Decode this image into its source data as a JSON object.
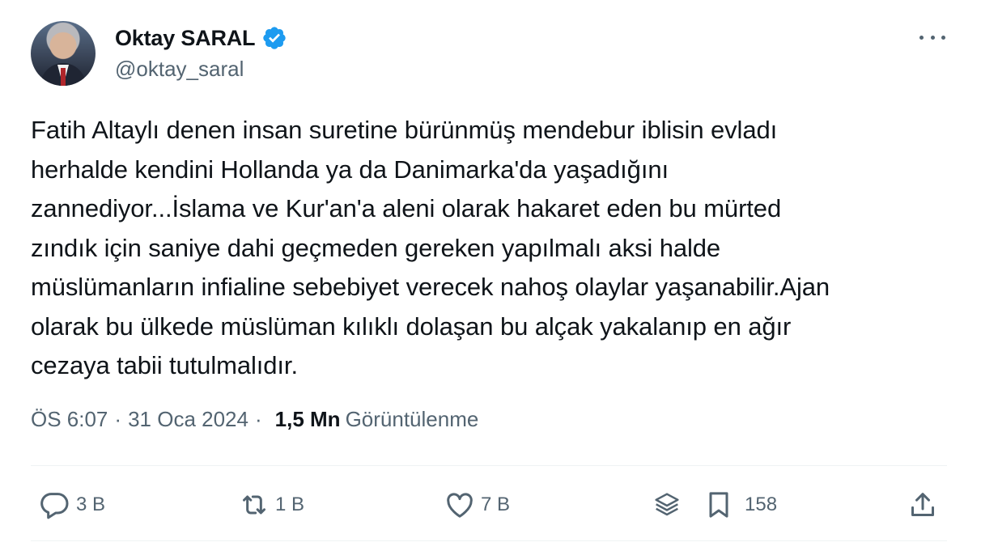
{
  "author": {
    "name": "Oktay SARAL",
    "handle": "@oktay_saral",
    "verified": true
  },
  "tweet": {
    "text": "Fatih Altaylı denen insan suretine bürünmüş mendebur iblisin evladı\nherhalde kendini Hollanda ya da Danimarka'da yaşadığını\nzannediyor...İslama ve Kur'an'a aleni olarak hakaret eden bu mürted\nzındık için saniye dahi geçmeden gereken yapılmalı aksi halde\nmüslümanların infialine sebebiyet verecek nahoş olaylar yaşanabilir.Ajan\nolarak bu ülkede müslüman kılıklı dolaşan bu alçak yakalanıp en ağır\ncezaya tabii tutulmalıdır."
  },
  "meta": {
    "time": "ÖS 6:07",
    "date": "31 Oca 2024",
    "separator": "·",
    "views_count": "1,5 Mn",
    "views_label": "Görüntülenme"
  },
  "actions": {
    "reply": {
      "icon": "reply-icon",
      "count": "3 B"
    },
    "retweet": {
      "icon": "retweet-icon",
      "count": "1 B"
    },
    "like": {
      "icon": "heart-icon",
      "count": "7 B"
    },
    "grok": {
      "icon": "layers-icon"
    },
    "bookmark": {
      "icon": "bookmark-icon",
      "count": "158"
    },
    "share": {
      "icon": "share-icon"
    }
  },
  "colors": {
    "text": "#0f1419",
    "secondary": "#536471",
    "verified": "#1d9bf0",
    "divider": "#eff3f4"
  }
}
